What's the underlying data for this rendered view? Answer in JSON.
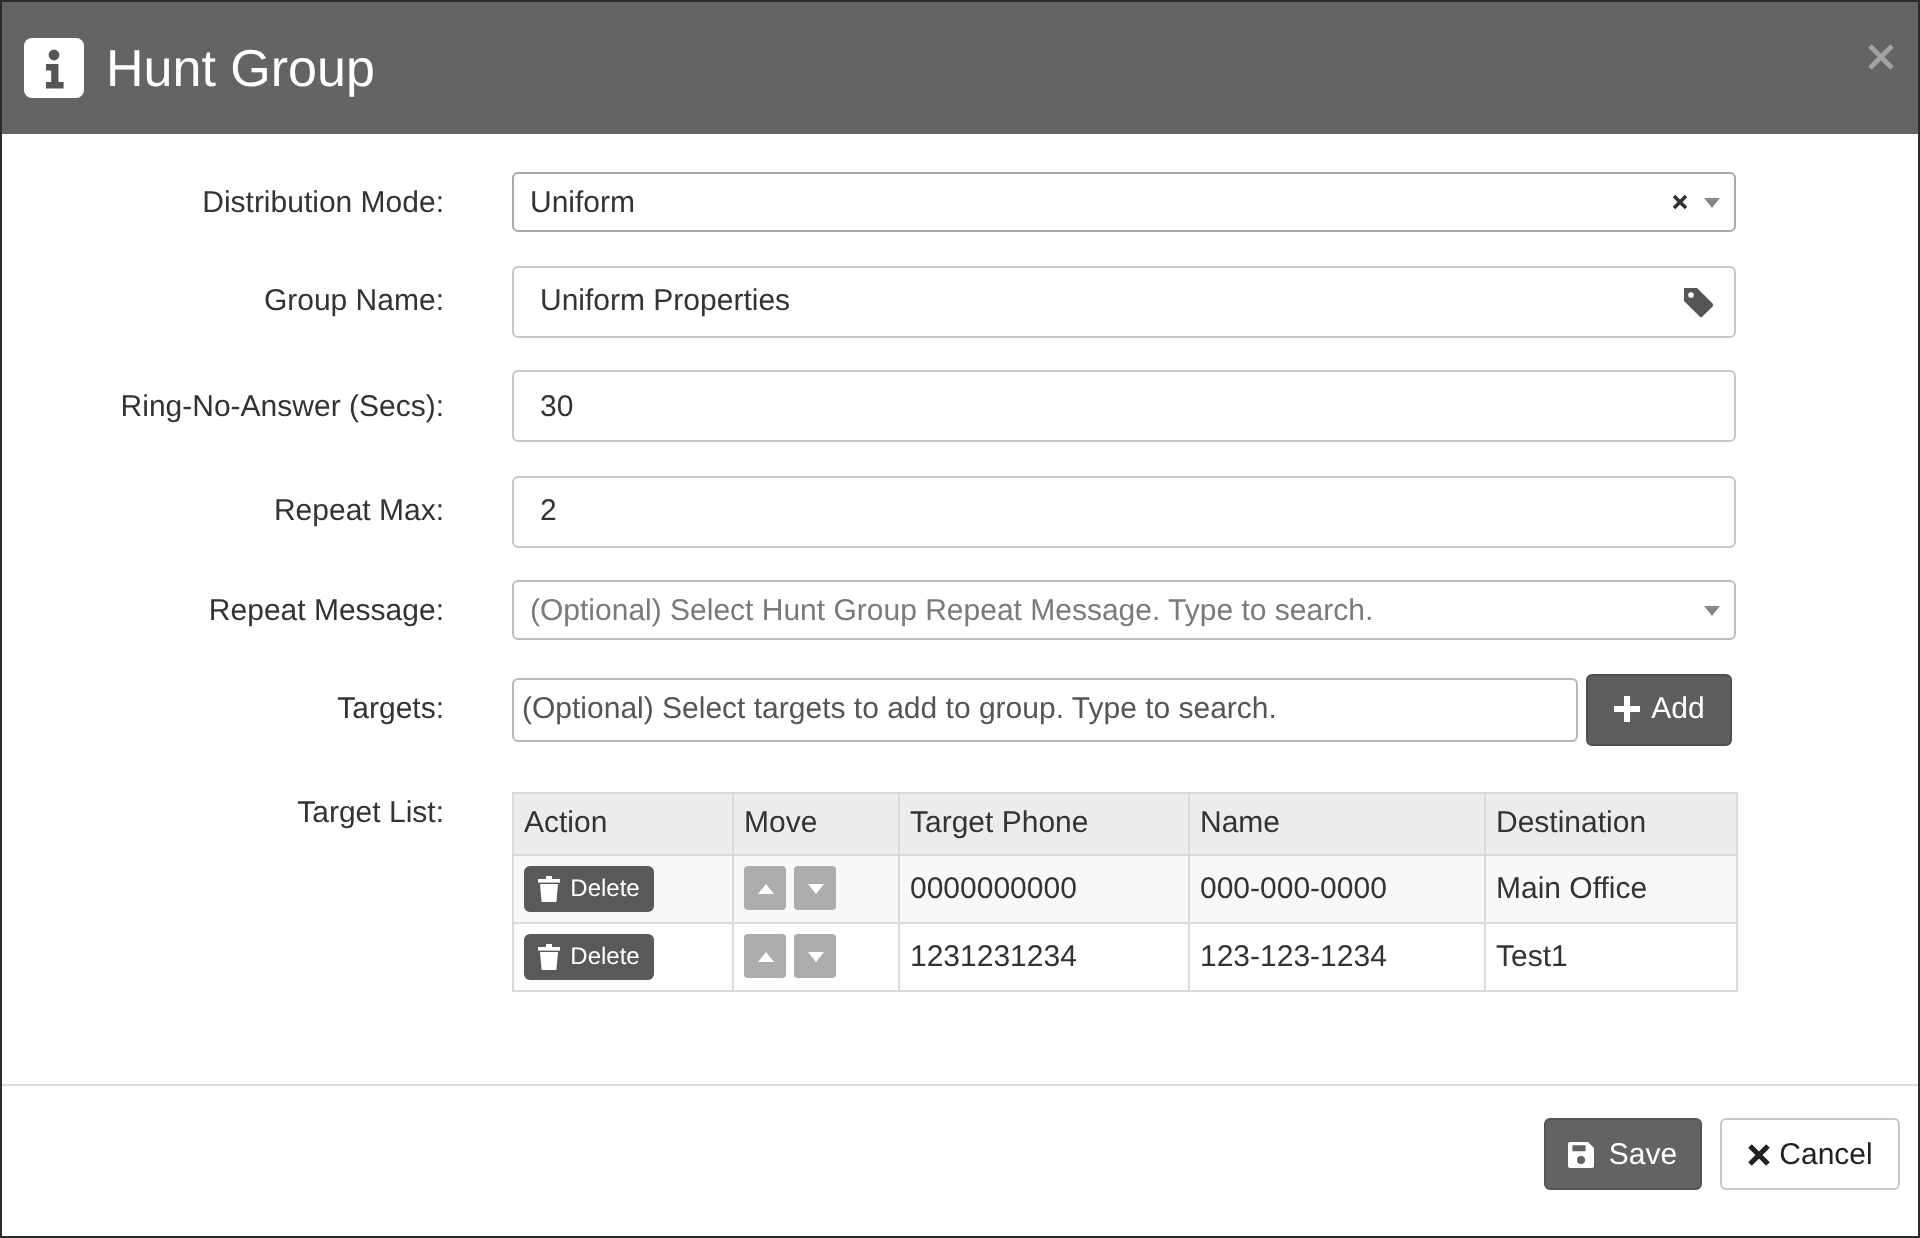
{
  "dialog": {
    "title": "Hunt Group"
  },
  "form": {
    "fields": [
      {
        "kind": "select",
        "label": "Distribution Mode:",
        "value": "Uniform",
        "clearable": true
      },
      {
        "kind": "tag",
        "label": "Group Name:",
        "value": "Uniform Properties"
      },
      {
        "kind": "text",
        "label": "Ring-No-Answer (Secs):",
        "value": "30"
      },
      {
        "kind": "text",
        "label": "Repeat Max:",
        "value": "2"
      },
      {
        "kind": "select",
        "label": "Repeat Message:",
        "placeholder": "(Optional) Select Hunt Group Repeat Message. Type to search.",
        "clearable": false
      },
      {
        "kind": "search",
        "label": "Targets:",
        "placeholder": "(Optional) Select targets to add to group. Type to search.",
        "button": "Add"
      }
    ]
  },
  "target_list": {
    "label": "Target List:",
    "columns": [
      "Action",
      "Move",
      "Target Phone",
      "Name",
      "Destination"
    ],
    "rows": [
      {
        "action": "Delete",
        "target_phone": "0000000000",
        "name": "000-000-0000",
        "destination": "Main Office"
      },
      {
        "action": "Delete",
        "target_phone": "1231231234",
        "name": "123-123-1234",
        "destination": "Test1"
      }
    ]
  },
  "footer": {
    "buttons": [
      {
        "kind": "primary",
        "label": "Save"
      },
      {
        "kind": "default",
        "label": "Cancel"
      }
    ]
  }
}
